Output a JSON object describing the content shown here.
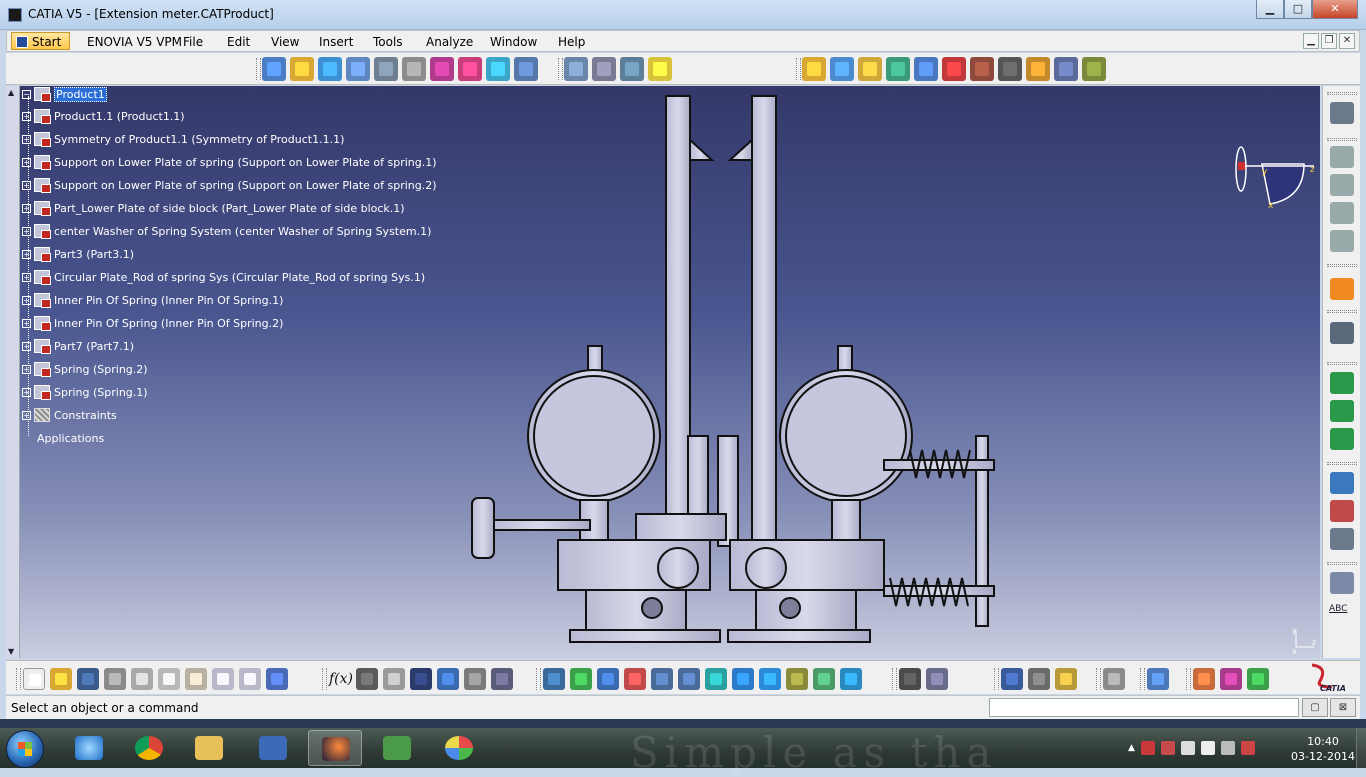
{
  "window": {
    "title": "CATIA V5 - [Extension meter.CATProduct]",
    "minimize": "▁",
    "maximize": "□",
    "close": "✕"
  },
  "menu": {
    "items": [
      "Start",
      "ENOVIA V5 VPM",
      "File",
      "Edit",
      "View",
      "Insert",
      "Tools",
      "Analyze",
      "Window",
      "Help"
    ]
  },
  "tree": {
    "root": "Product1",
    "items": [
      "Product1.1 (Product1.1)",
      "Symmetry of Product1.1 (Symmetry of Product1.1.1)",
      "Support on Lower Plate of spring (Support on Lower Plate of spring.1)",
      "Support on Lower Plate of spring (Support on Lower Plate of spring.2)",
      "Part_Lower Plate of side block (Part_Lower Plate of side block.1)",
      "center Washer of Spring System (center Washer of Spring System.1)",
      "Part3 (Part3.1)",
      "Circular Plate_Rod of spring Sys (Circular Plate_Rod of spring Sys.1)",
      "Inner Pin Of Spring (Inner Pin Of Spring.1)",
      "Inner Pin Of Spring (Inner Pin Of Spring.2)",
      "Part7 (Part7.1)",
      "Spring (Spring.2)",
      "Spring (Spring.1)",
      "Constraints"
    ],
    "applications": "Applications"
  },
  "compass": {
    "y": "y",
    "z": "z",
    "x": "x"
  },
  "view_axes": {
    "y": "y",
    "z": "z",
    "x": "x"
  },
  "right_toolbar": {
    "abc": "ABC"
  },
  "bottom_toolbar": {
    "fx_label": "f(x)"
  },
  "status": {
    "message": "Select an object or a command",
    "command_value": ""
  },
  "taskbar": {
    "time": "10:40",
    "date": "03-12-2014",
    "wallpaper": "Simple as tha"
  },
  "colors": {
    "viewport_top": "#343869",
    "viewport_bottom": "#c9cde0",
    "selection": "#2a6dd6",
    "part": "#c8c8de"
  }
}
